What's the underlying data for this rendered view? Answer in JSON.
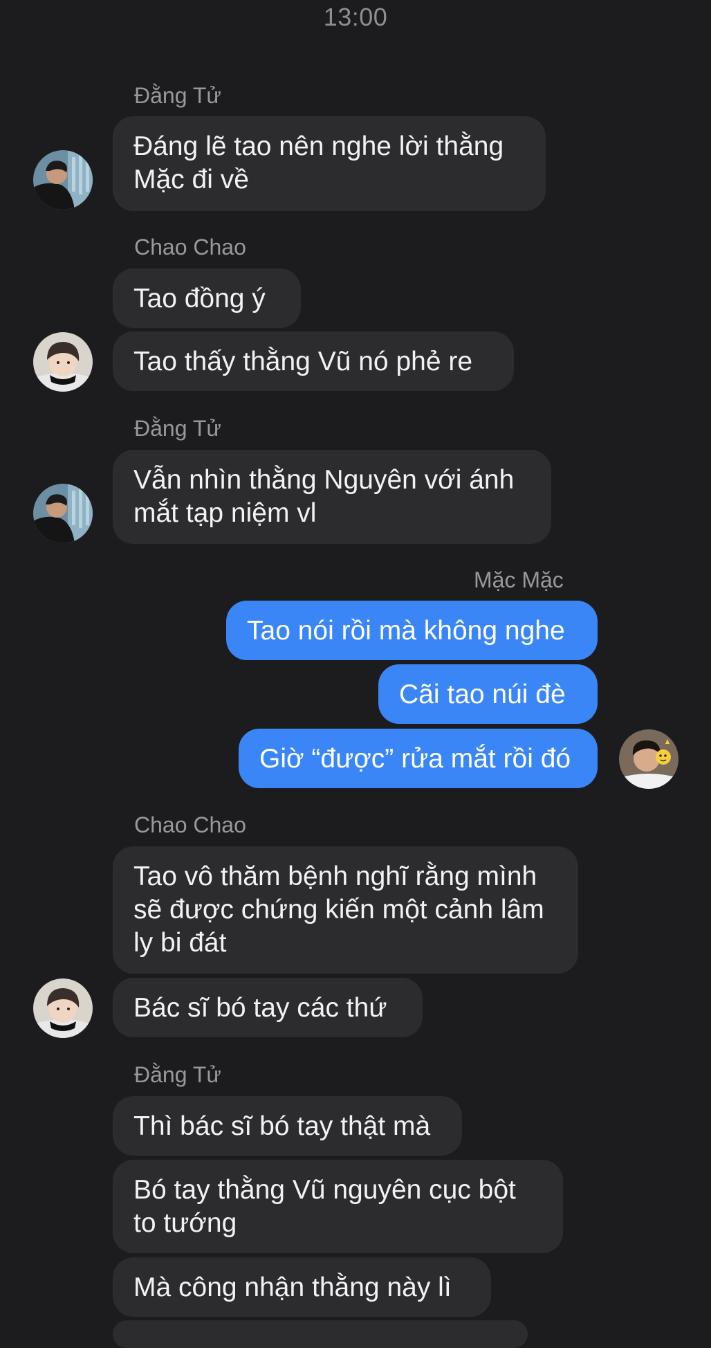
{
  "status": {
    "time": "13:00"
  },
  "messages": [
    {
      "sender": "Đằng Tử",
      "bubbles": [
        "Đáng lẽ tao nên nghe lời thằng\nMặc đi về"
      ]
    },
    {
      "sender": "Chao Chao",
      "bubbles": [
        "Tao đồng ý",
        "Tao thấy thằng Vũ nó phẻ re"
      ]
    },
    {
      "sender": "Đằng Tử",
      "bubbles": [
        "Vẫn nhìn thằng Nguyên với ánh\nmắt tạp niệm vl"
      ]
    },
    {
      "sender": "Mặc Mặc",
      "bubbles": [
        "Tao nói rồi mà không nghe",
        "Cãi tao núi đè",
        "Giờ “được” rửa mắt rồi đó"
      ]
    },
    {
      "sender": "Chao Chao",
      "bubbles": [
        "Tao vô thăm bệnh nghĩ rằng mình\nsẽ được chứng kiến một cảnh lâm\nly bi đát",
        "Bác sĩ bó tay các thứ"
      ]
    },
    {
      "sender": "Đằng Tử",
      "bubbles": [
        "Thì bác sĩ bó tay thật mà",
        "Bó tay thằng Vũ nguyên cục bột\nto tướng",
        "Mà công nhận thằng này lì"
      ]
    }
  ],
  "colors": {
    "background": "#1c1c1e",
    "incoming_bubble": "#2c2c2e",
    "outgoing_bubble": "#3b86f7",
    "sender_name": "#98989e"
  },
  "icons": {
    "dang_tu_avatar": "avatar-photo-dang-tu",
    "chao_chao_avatar": "avatar-photo-chao-chao",
    "mac_mac_avatar": "avatar-photo-mac-mac"
  }
}
